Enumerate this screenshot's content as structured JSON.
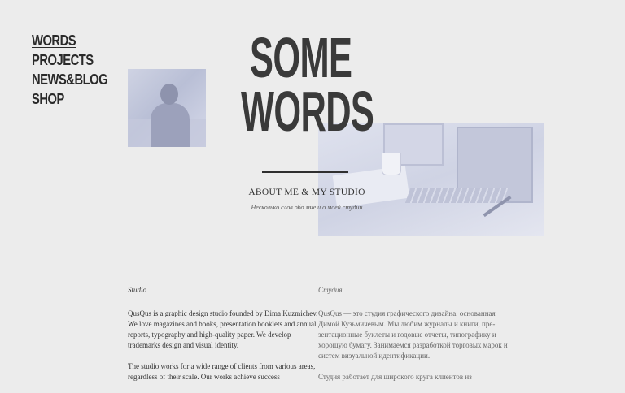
{
  "nav": {
    "items": [
      {
        "label": "Words",
        "active": true
      },
      {
        "label": "Projects"
      },
      {
        "label": "News&Blog"
      },
      {
        "label": "Shop"
      }
    ]
  },
  "hero": {
    "title_line1": "Some",
    "title_line2": "Words",
    "subtitle": "ABOUT ME & MY STUDIO",
    "subtitle_ru": "Несколько слов обо мне и о моей студии"
  },
  "columns": {
    "en": {
      "heading": "Studio",
      "p1": "QusQus is a graphic design studio founded by Dima Kuzmichev. We love magazines and books, presentation booklets and annual reports, typography and high-quality paper. We develop trademarks design and visual identity.",
      "p2": "The studio works for a wide range of clients from various areas, regardless of their scale. Our works achieve success"
    },
    "ru": {
      "heading": "Студия",
      "p1": "QusQus — это студия графического дизайна, основанная Димой Кузьмичевым. Мы любим журналы и книги, пре-зентационные буклеты и годовые отчеты, типографику и хорошую бумагу. Занимаемся разработкой торговых марок и систем визуальной идентификации.",
      "p2": "Студия работает для широкого круга клиентов из"
    }
  },
  "colors": {
    "background": "#ececec",
    "text": "#333333",
    "photo_tint": "#c9cde0"
  }
}
